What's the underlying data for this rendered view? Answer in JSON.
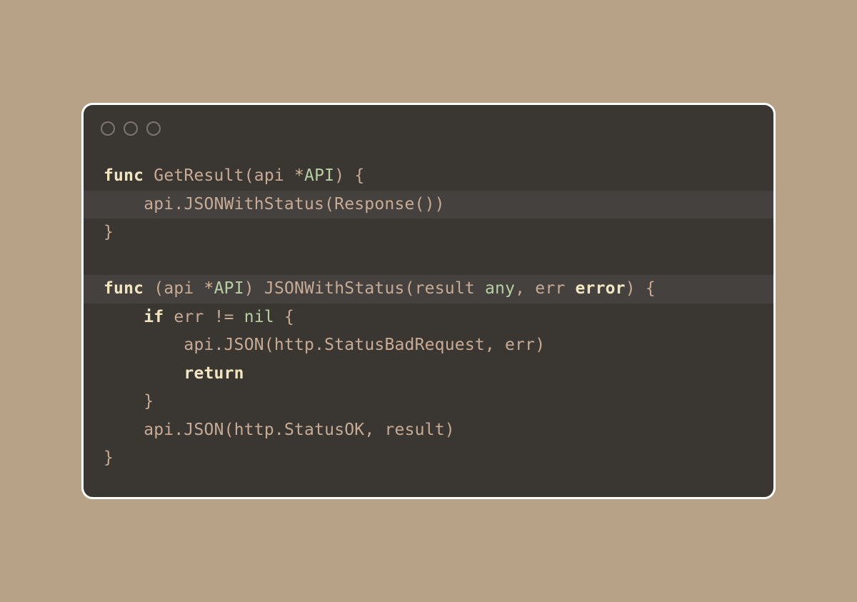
{
  "colors": {
    "bg": "#b7a287",
    "editor": "#3a3733",
    "keyword": "#f1e6c0",
    "type": "#b7cfa3",
    "text": "#c7ab94"
  },
  "window": {
    "title": "code-editor"
  },
  "code": {
    "indent": "    ",
    "tokens": {
      "func": "func",
      "if": "if",
      "return": "return",
      "nil": "nil",
      "error": "error",
      "any": "any",
      "neq": "!=",
      "ptr": "*",
      "GetResult": "GetResult",
      "api": "api",
      "API": "API",
      "JSONWithStatus": "JSONWithStatus",
      "Response": "Response",
      "result": "result",
      "err": "err",
      "JSON": "JSON",
      "http": "http",
      "StatusBadRequest": "StatusBadRequest",
      "StatusOK": "StatusOK",
      "openBrace": "{",
      "closeBrace": "}",
      "openParen": "(",
      "closeParen": ")",
      "comma": ",",
      "dot": "."
    }
  }
}
